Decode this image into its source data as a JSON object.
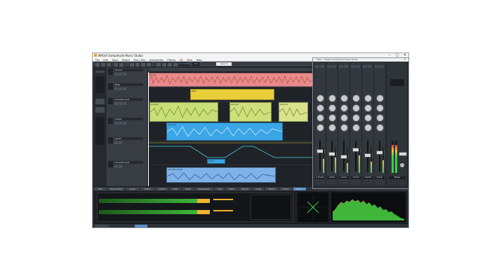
{
  "app": {
    "title": "MAGIX Samplitude Music Studio"
  },
  "window_controls": {
    "minimize": "–",
    "maximize": "□",
    "close": "✕"
  },
  "menu": [
    "File",
    "Edit",
    "Track",
    "Object",
    "Play / Rec",
    "Automation",
    "Effects",
    "CD",
    "View",
    "Help"
  ],
  "toolbar": {
    "position": "1:01:000",
    "tempo": "120",
    "search_placeholder": "Search"
  },
  "tracks": [
    {
      "name": "Drums",
      "color": "#e57a7a"
    },
    {
      "name": "Bass",
      "color": "#e8cf3a"
    },
    {
      "name": "Acoustic Guit.",
      "color": "#cfe07a"
    },
    {
      "name": "Vocals",
      "color": "#39a8e6"
    },
    {
      "name": "Synth",
      "color": "#39a8e6"
    },
    {
      "name": "Acoustic Guit.",
      "color": "#7fb2e8"
    }
  ],
  "clips": {
    "drums": "Drums",
    "bass": "Bass",
    "guitar_a": "Guit_01",
    "guitar_b": "Guit_02",
    "guitar_c": "Guit_03",
    "vocals": "Vocal_01",
    "synth": "Synth",
    "guitar_d": "Acoustic Guitar"
  },
  "bottom_tabs": [
    "Files",
    "Object Editor",
    "Audio",
    "Editor",
    "Marker",
    "Tools",
    "Mixer",
    "Visualisation",
    "Clip",
    "Track",
    "Plugins",
    "Loops",
    "Effects",
    "Import",
    "Export"
  ],
  "mixer": {
    "title": "Mixer - MAGIX Samplitude Music Studio",
    "channels": [
      "1 Drums",
      "2 Bass",
      "3 Guit.",
      "4 Vocal",
      "5 Synth",
      "6 Guit."
    ],
    "master": "Master",
    "levels": [
      0.55,
      0.62,
      0.38,
      0.7,
      0.45,
      0.5
    ]
  },
  "colors": {
    "accent": "#39a8e6",
    "meter_green": "#38d04a",
    "meter_yellow": "#f0c23a",
    "clip_red": "#e57a7a"
  }
}
